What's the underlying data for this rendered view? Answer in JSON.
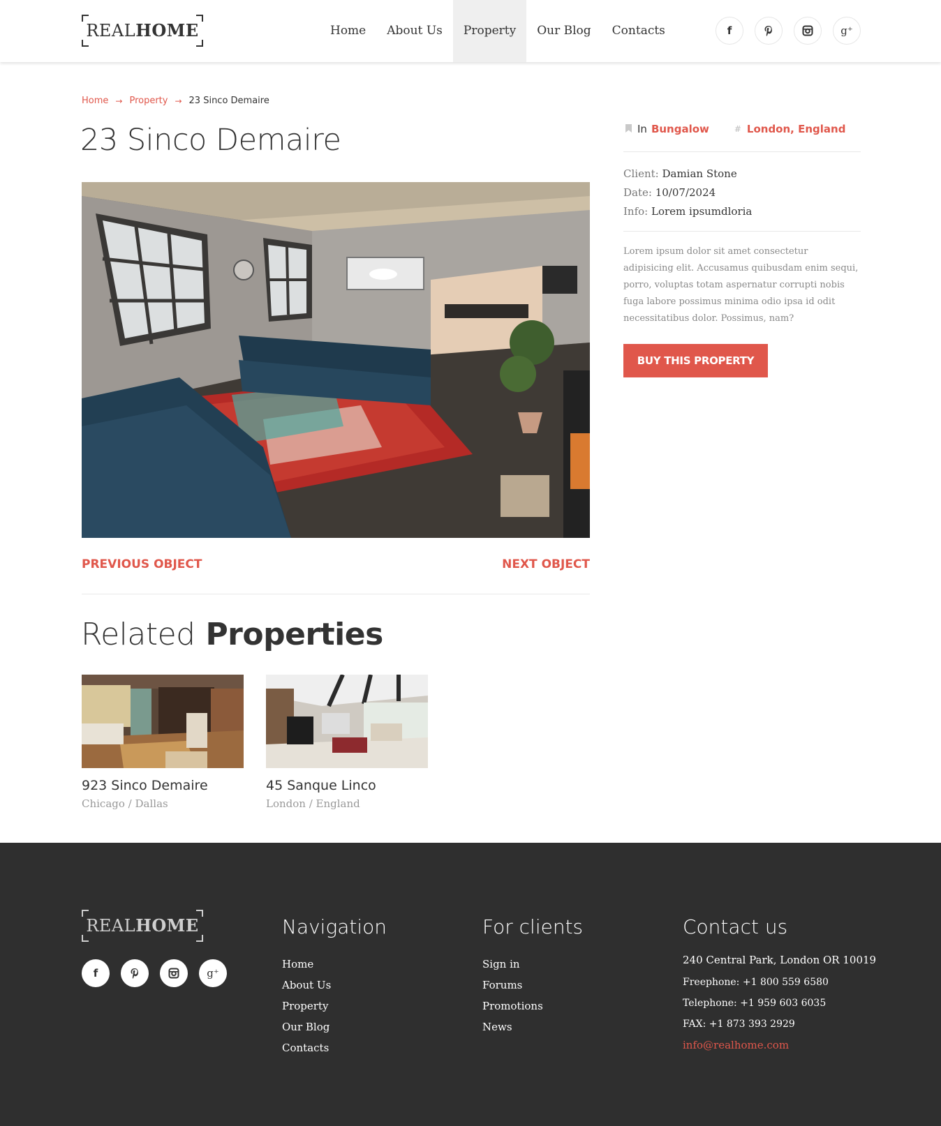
{
  "logo": {
    "part1": "REAL",
    "part2": "HOME"
  },
  "nav": {
    "items": [
      {
        "label": "Home"
      },
      {
        "label": "About Us"
      },
      {
        "label": "Property",
        "active": true
      },
      {
        "label": "Our Blog"
      },
      {
        "label": "Contacts"
      }
    ]
  },
  "social": [
    {
      "icon": "facebook-icon",
      "glyph": "f"
    },
    {
      "icon": "pinterest-icon",
      "glyph": "𝓅"
    },
    {
      "icon": "instagram-icon",
      "glyph": "◘"
    },
    {
      "icon": "google-plus-icon",
      "glyph": "g⁺"
    }
  ],
  "breadcrumb": {
    "home": "Home",
    "property": "Property",
    "current": "23 Sinco Demaire",
    "arrow": "→"
  },
  "property": {
    "title": "23 Sinco Demaire",
    "category_prefix": "In",
    "category": "Bungalow",
    "location": "London, England",
    "client_label": "Client:",
    "client": "Damian Stone",
    "date_label": "Date:",
    "date": "10/07/2024",
    "info_label": "Info:",
    "info": "Lorem ipsumdloria",
    "description": "Lorem ipsum dolor sit amet consectetur adipisicing elit. Accusamus quibusdam enim sequi, porro, voluptas totam aspernatur corrupti nobis fuga labore possimus minima odio ipsa id odit necessitatibus dolor. Possimus, nam?",
    "buy_label": "BUY THIS PROPERTY"
  },
  "pager": {
    "prev": "PREVIOUS OBJECT",
    "next": "NEXT OBJECT"
  },
  "related": {
    "heading_light": "Related",
    "heading_bold": "Properties",
    "items": [
      {
        "name": "923 Sinco Demaire",
        "location": "Chicago / Dallas"
      },
      {
        "name": "45 Sanque Linco",
        "location": "London / England"
      }
    ]
  },
  "footer": {
    "nav_title": "Navigation",
    "nav_items": [
      "Home",
      "About Us",
      "Property",
      "Our Blog",
      "Contacts"
    ],
    "clients_title": "For clients",
    "clients_items": [
      "Sign in",
      "Forums",
      "Promotions",
      "News"
    ],
    "contact_title": "Contact us",
    "address": "240 Central Park, London OR 10019",
    "freephone_label": "Freephone:",
    "freephone": "+1 800 559 6580",
    "telephone_label": "Telephone:",
    "telephone": "+1 959 603 6035",
    "fax_label": "FAX:",
    "fax": "+1 873 393 2929",
    "email": "info@realhome.com"
  },
  "colors": {
    "accent": "#e0574b",
    "footer_bg": "#2f2f2f"
  }
}
